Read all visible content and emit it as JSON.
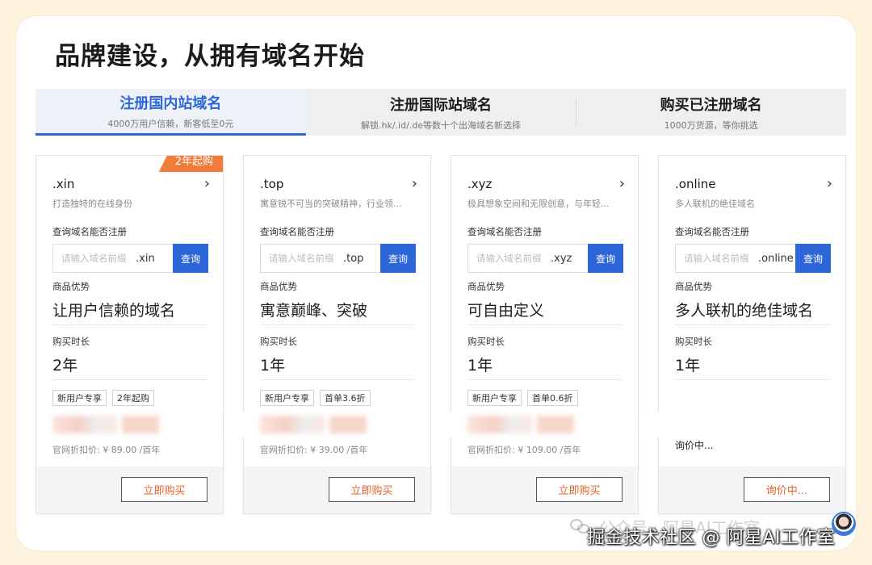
{
  "page": {
    "title": "品牌建设，从拥有域名开始"
  },
  "tabs": [
    {
      "title": "注册国内站域名",
      "subtitle": "4000万用户信赖，新客低至0元",
      "active": true
    },
    {
      "title": "注册国际站域名",
      "subtitle": "解锁.hk/.id/.de等数十个出海域名新选择",
      "active": false
    },
    {
      "title": "购买已注册域名",
      "subtitle": "1000万货源，等你挑选",
      "active": false
    }
  ],
  "labels": {
    "query": "查询域名能否注册",
    "placeholder": "请输入域名前缀",
    "search_button": "查询",
    "advantage": "商品优势",
    "duration": "购买时长"
  },
  "cards": [
    {
      "ribbon": "2年起购",
      "name": ".xin",
      "desc": "打造独特的在线身份",
      "suffix": ".xin",
      "advantage": "让用户信赖的域名",
      "duration": "2年",
      "tags": [
        "新用户专享",
        "2年起购"
      ],
      "official_price": "官网折扣价: ¥ 89.00 /首年",
      "button": "立即购买"
    },
    {
      "name": ".top",
      "desc": "寓意锐不可当的突破精神，行业领...",
      "suffix": ".top",
      "advantage": "寓意巅峰、突破",
      "duration": "1年",
      "tags": [
        "新用户专享",
        "首单3.6折"
      ],
      "official_price": "官网折扣价: ¥ 39.00 /首年",
      "button": "立即购买"
    },
    {
      "name": ".xyz",
      "desc": "极具想象空间和无限创意，与年轻...",
      "suffix": ".xyz",
      "advantage": "可自由定义",
      "duration": "1年",
      "tags": [
        "新用户专享",
        "首单0.6折"
      ],
      "official_price": "官网折扣价: ¥ 109.00 /首年",
      "button": "立即购买"
    },
    {
      "name": ".online",
      "desc": "多人联机的绝佳域名",
      "suffix": ".online",
      "advantage": "多人联机的绝佳域名",
      "duration": "1年",
      "inquiry": "询价中...",
      "button": "询价中..."
    }
  ],
  "watermark": {
    "faint": "公众号 · 阿星AI工作室",
    "main": "掘金技术社区 @ 阿星AI工作室"
  },
  "colors": {
    "accent": "#2c66d8",
    "orange": "#f07b3a",
    "button_text": "#e8622a"
  }
}
